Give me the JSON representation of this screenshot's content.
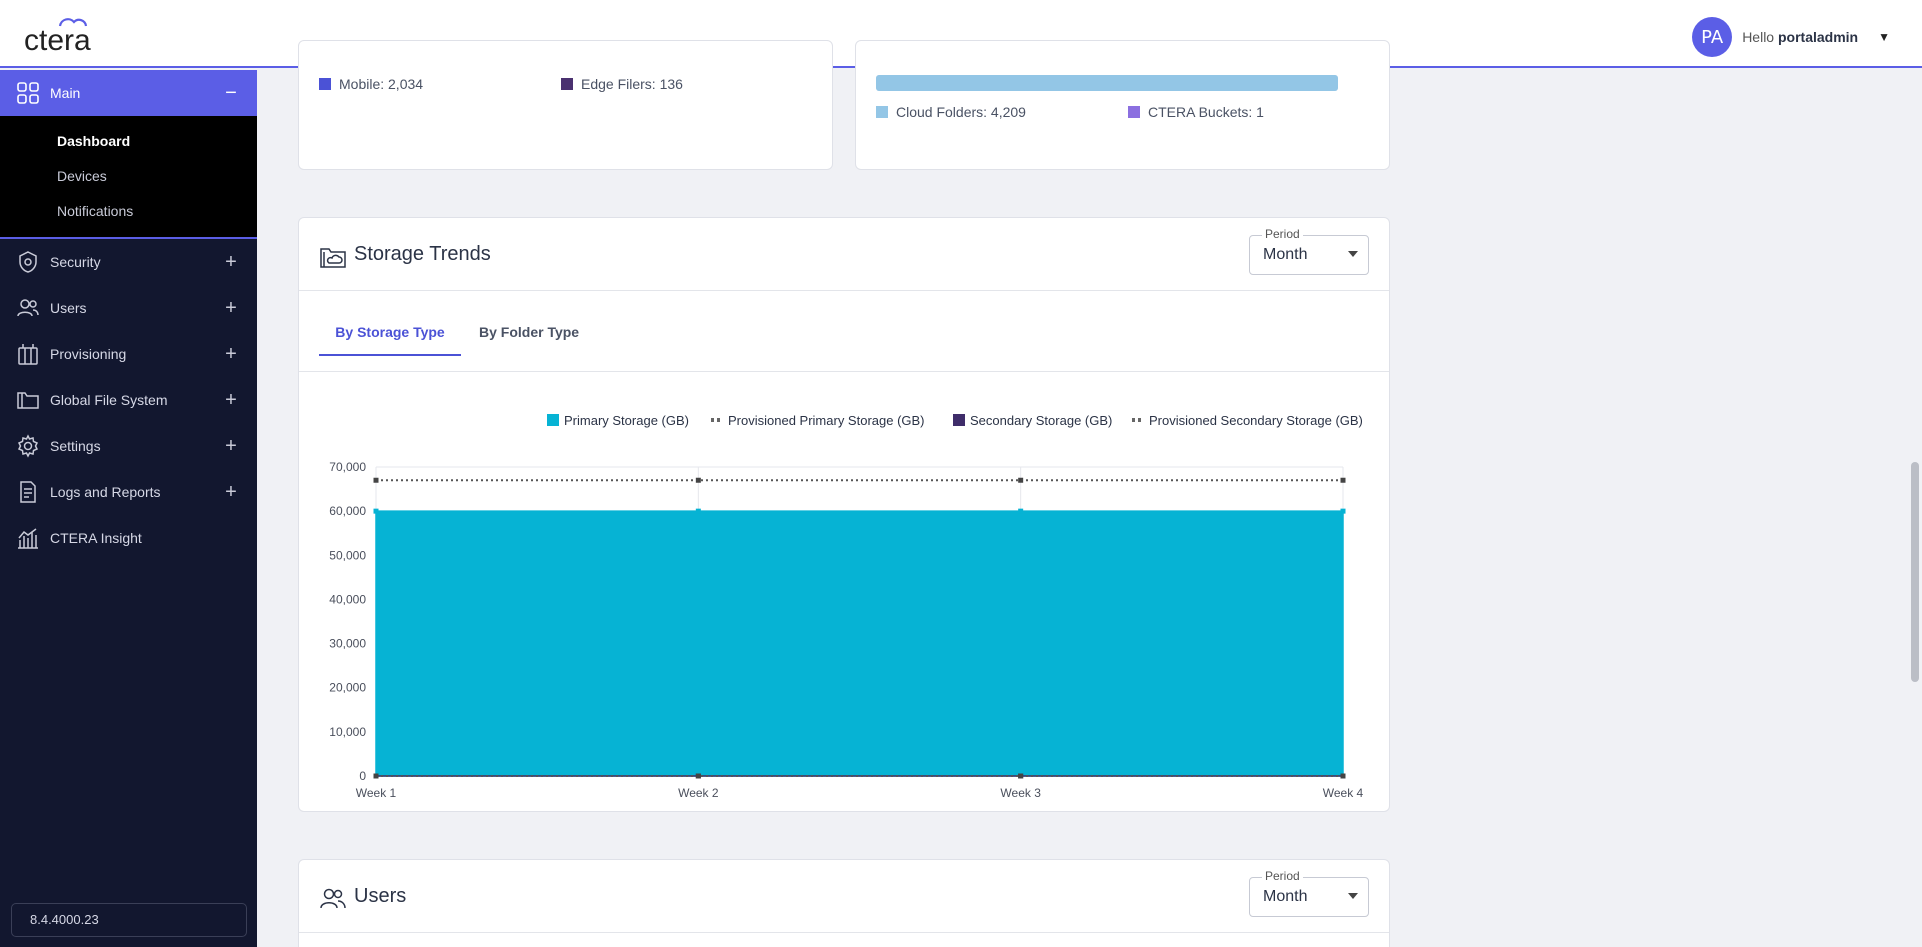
{
  "header": {
    "logo_text": "ctera",
    "avatar_initials": "PA",
    "greeting": "Hello",
    "username": "portaladmin"
  },
  "sidebar": {
    "main": {
      "label": "Main",
      "toggle": "−"
    },
    "sub_items": [
      {
        "label": "Dashboard",
        "active": true
      },
      {
        "label": "Devices"
      },
      {
        "label": "Notifications"
      }
    ],
    "items": [
      {
        "label": "Security",
        "icon": "shield-icon"
      },
      {
        "label": "Users",
        "icon": "users-icon"
      },
      {
        "label": "Provisioning",
        "icon": "provisioning-icon"
      },
      {
        "label": "Global File System",
        "icon": "folder-icon"
      },
      {
        "label": "Settings",
        "icon": "gear-icon"
      },
      {
        "label": "Logs and Reports",
        "icon": "report-icon"
      },
      {
        "label": "CTERA Insight",
        "icon": "insight-chart-icon"
      }
    ],
    "version": "8.4.4000.23"
  },
  "top_cards": {
    "left_legend": [
      {
        "label": "Mobile: 2,034",
        "color": "#4b52d6"
      },
      {
        "label": "Edge Filers: 136",
        "color": "#4a3170"
      }
    ],
    "right_legend": [
      {
        "label": "Cloud Folders: 4,209",
        "color": "#93c6e6"
      },
      {
        "label": "CTERA Buckets: 1",
        "color": "#8b6fe0"
      }
    ],
    "cloud_folders_bar_fraction": 0.9998
  },
  "storage_trends": {
    "title": "Storage Trends",
    "period_label": "Period",
    "period_value": "Month",
    "tabs": [
      "By Storage Type",
      "By Folder Type"
    ],
    "active_tab": 0
  },
  "chart_data": {
    "type": "area",
    "x": [
      "Week 1",
      "Week 2",
      "Week 3",
      "Week 4"
    ],
    "ylim": [
      0,
      70000
    ],
    "yticks": [
      "0",
      "10,000",
      "20,000",
      "30,000",
      "40,000",
      "50,000",
      "60,000",
      "70,000"
    ],
    "grid": true,
    "legend_position": "top-right",
    "series": [
      {
        "name": "Primary Storage (GB)",
        "style": "area",
        "color": "#06b3d4",
        "values": [
          60000,
          60000,
          60000,
          60000
        ]
      },
      {
        "name": "Provisioned Primary Storage (GB)",
        "style": "dotted",
        "color": "#555555",
        "values": [
          67000,
          67000,
          67000,
          67000
        ]
      },
      {
        "name": "Secondary Storage (GB)",
        "style": "area",
        "color": "#3f2d6a",
        "values": [
          0,
          0,
          0,
          0
        ]
      },
      {
        "name": "Provisioned Secondary Storage (GB)",
        "style": "dotted",
        "color": "#555555",
        "values": [
          0,
          0,
          0,
          0
        ]
      }
    ]
  },
  "users_card": {
    "title": "Users",
    "period_label": "Period",
    "period_value": "Month"
  }
}
